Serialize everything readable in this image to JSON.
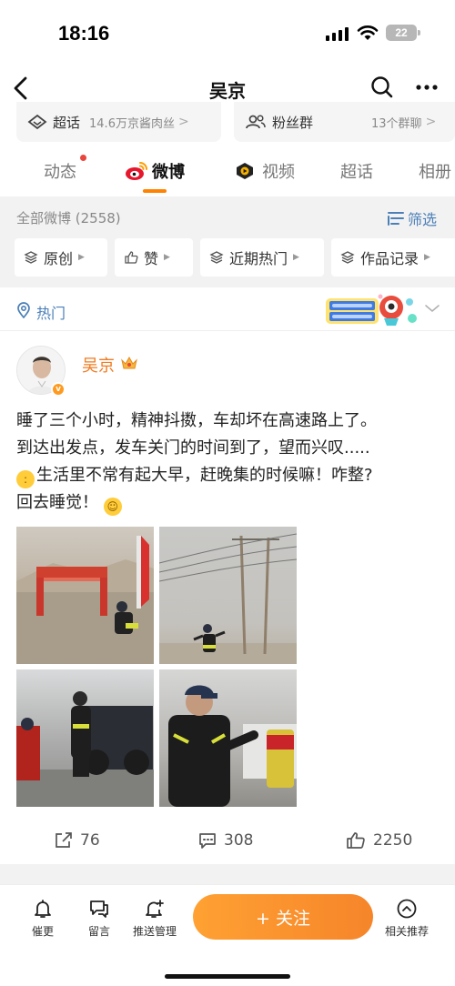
{
  "status_bar": {
    "time": "18:16",
    "battery": "22"
  },
  "nav": {
    "title": "吴京"
  },
  "chips": [
    {
      "label": "超话",
      "sub": "14.6万京酱肉丝",
      "arrow": ">"
    },
    {
      "label": "粉丝群",
      "sub": "13个群聊",
      "arrow": ">"
    }
  ],
  "tabs": [
    {
      "label": "动态"
    },
    {
      "label": "微博"
    },
    {
      "label": "视频"
    },
    {
      "label": "超话"
    },
    {
      "label": "相册"
    }
  ],
  "filter": {
    "summary": "全部微博 (2558)",
    "filter_label": "筛选",
    "pills": [
      "原创",
      "赞",
      "近期热门",
      "作品记录"
    ]
  },
  "hot": {
    "label": "热门"
  },
  "post": {
    "author": "吴京",
    "text_line1": "睡了三个小时，精神抖擞，车却坏在高速路上了。",
    "text_line2": "到达出发点，发车关门的时间到了，望而兴叹.....",
    "text_line3": "生活里不常有起大早，赶晚集的时候嘛！咋整?",
    "text_line4": "回去睡觉！",
    "reposts": "76",
    "comments": "308",
    "likes": "2250"
  },
  "bottom_bar": {
    "items": [
      "催更",
      "留言",
      "推送管理",
      "相关推荐"
    ],
    "follow": "+ 关注"
  },
  "colors": {
    "accent": "#ff8200",
    "link_blue": "#4b7fb8",
    "author_orange": "#f07b22"
  }
}
